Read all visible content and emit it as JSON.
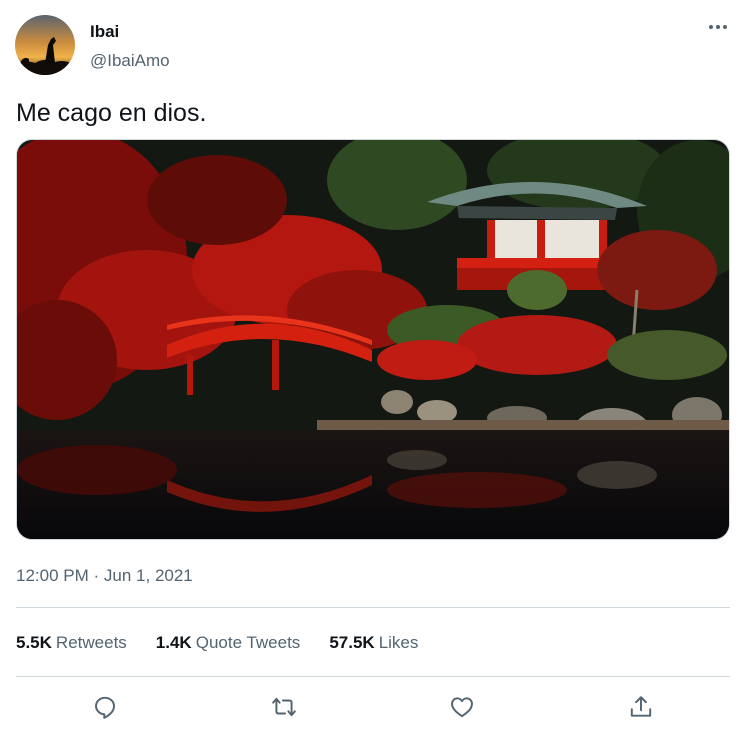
{
  "author": {
    "display_name": "Ibai",
    "handle": "@IbaiAmo"
  },
  "tweet": {
    "text": "Me cago en dios.",
    "time": "12:00 PM",
    "separator": "·",
    "date": "Jun 1, 2021"
  },
  "stats": {
    "retweets": {
      "count": "5.5K",
      "label": "Retweets"
    },
    "quote_tweets": {
      "count": "1.4K",
      "label": "Quote Tweets"
    },
    "likes": {
      "count": "57.5K",
      "label": "Likes"
    }
  },
  "actions": {
    "icons": [
      "reply-icon",
      "retweet-icon",
      "like-icon",
      "share-icon"
    ]
  },
  "colors": {
    "text_primary": "#0f1419",
    "text_secondary": "#536471",
    "divider": "#cfd9de",
    "background": "#ffffff"
  }
}
